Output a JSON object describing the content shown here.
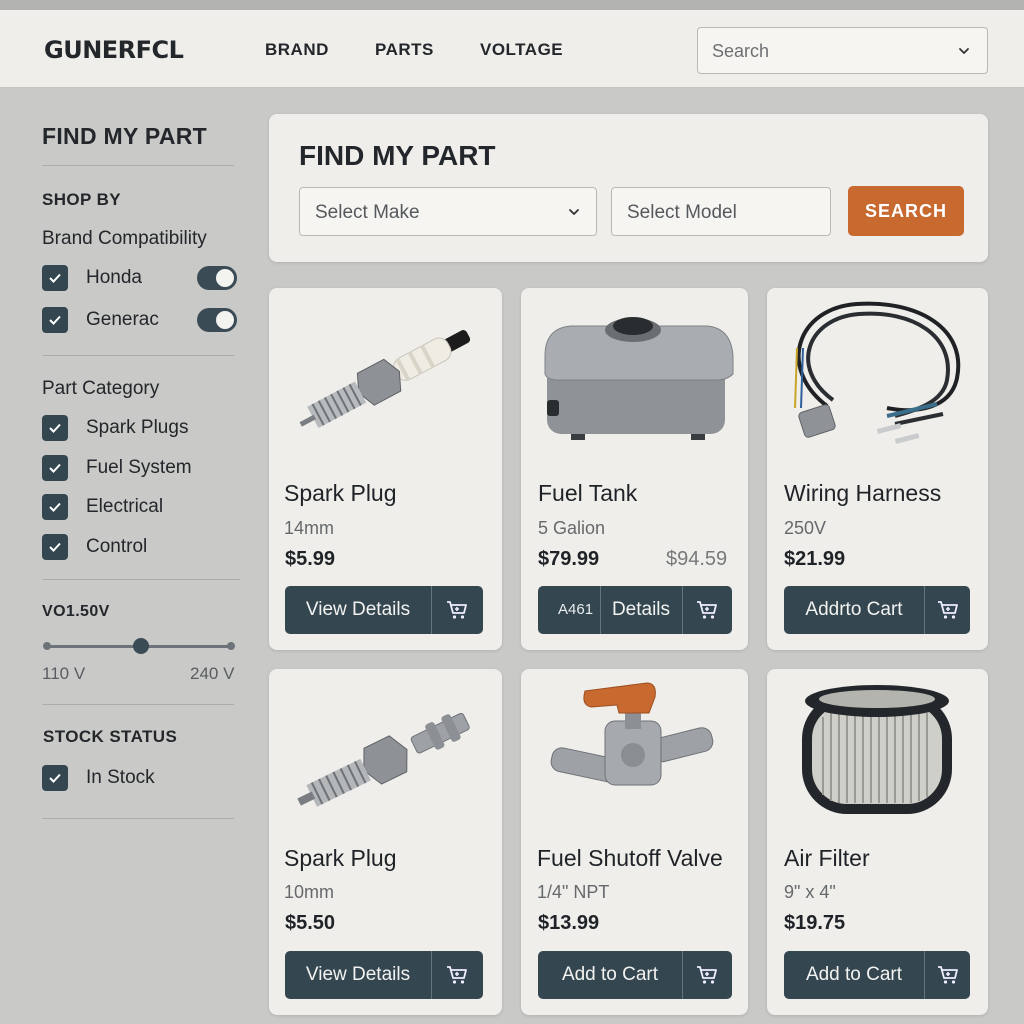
{
  "header": {
    "logo": "GUNERFCL",
    "nav": [
      "BRAND",
      "PARTS",
      "VOLTAGE"
    ],
    "search_placeholder": "Search"
  },
  "sidebar": {
    "title": "FIND MY PART",
    "shop_by": "SHOP BY",
    "brand_heading": "Brand Compatibility",
    "brands": [
      {
        "label": "Honda",
        "checked": true,
        "toggle_on": true
      },
      {
        "label": "Generac",
        "checked": true,
        "toggle_on": true
      }
    ],
    "category_heading": "Part Category",
    "categories": [
      {
        "label": "Spark Plugs",
        "checked": true
      },
      {
        "label": "Fuel System",
        "checked": true
      },
      {
        "label": "Electrical",
        "checked": true
      },
      {
        "label": "Control",
        "checked": true
      }
    ],
    "voltage_heading": "VO1.50V",
    "voltage_min": "110 V",
    "voltage_max": "240 V",
    "voltage_level": 0.5,
    "stock_heading": "STOCK STATUS",
    "stock": [
      {
        "label": "In Stock",
        "checked": true
      }
    ]
  },
  "finder": {
    "title": "FIND MY PART",
    "make_placeholder": "Select Make",
    "model_placeholder": "Select Model",
    "search_label": "SEARCH"
  },
  "products": [
    {
      "name": "Spark Plug",
      "spec": "14mm",
      "price": "$5.99",
      "button": "View Details",
      "icon": "spark-plug"
    },
    {
      "name": "Fuel Tank",
      "spec": "5 Galion",
      "price": "$79.99",
      "old_price": "$94.59",
      "badge": "A461",
      "button": "Details",
      "icon": "fuel-tank"
    },
    {
      "name": "Wiring Harness",
      "spec": "250V",
      "price": "$21.99",
      "button": "Addrto Cart",
      "icon": "wiring-harness"
    },
    {
      "name": "Spark Plug",
      "spec": "10mm",
      "price": "$5.50",
      "button": "View Details",
      "icon": "spark-plug"
    },
    {
      "name": "Fuel Shutoff Valve",
      "spec": "1/4\" NPT",
      "price": "$13.99",
      "button": "Add to Cart",
      "icon": "valve"
    },
    {
      "name": "Air Filter",
      "spec": "9\" x 4\"",
      "price": "$19.75",
      "button": "Add to Cart",
      "icon": "air-filter"
    }
  ],
  "colors": {
    "accent": "#c8692f",
    "button_dark": "#344650",
    "background": "#c9c9c7",
    "panel": "#efeeea"
  }
}
